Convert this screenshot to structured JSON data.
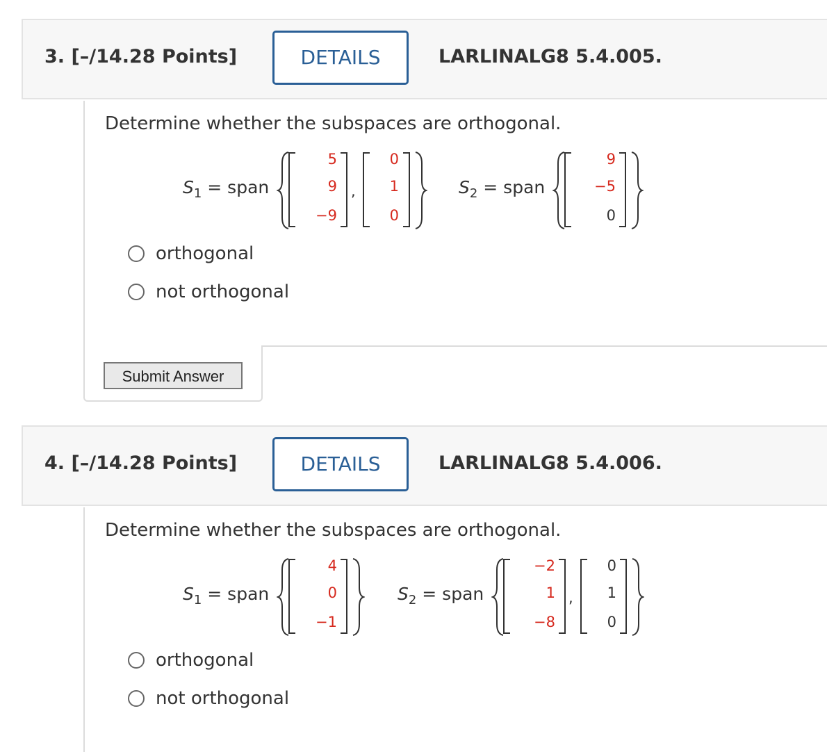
{
  "questions": [
    {
      "number_label": "3. [–/14.28 Points]",
      "details_label": "DETAILS",
      "book_code": "LARLINALG8 5.4.005.",
      "prompt": "Determine whether the subspaces are orthogonal.",
      "s1_label": "S",
      "s1_sub": "1",
      "s2_label": "S",
      "s2_sub": "2",
      "eq_span": " = span",
      "s1_vectors": [
        [
          "5",
          "9",
          "−9"
        ],
        [
          "0",
          "1",
          "0"
        ]
      ],
      "s2_vectors": [
        [
          "9",
          "−5",
          "0"
        ]
      ],
      "comma": ",",
      "options": [
        "orthogonal",
        "not orthogonal"
      ],
      "submit_label": "Submit Answer"
    },
    {
      "number_label": "4. [–/14.28 Points]",
      "details_label": "DETAILS",
      "book_code": "LARLINALG8 5.4.006.",
      "prompt": "Determine whether the subspaces are orthogonal.",
      "s1_label": "S",
      "s1_sub": "1",
      "s2_label": "S",
      "s2_sub": "2",
      "eq_span": " = span",
      "s1_vectors": [
        [
          "4",
          "0",
          "−1"
        ]
      ],
      "s2_vectors": [
        [
          "−2",
          "1",
          "−8"
        ],
        [
          "0",
          "1",
          "0"
        ]
      ],
      "comma": ",",
      "options": [
        "orthogonal",
        "not orthogonal"
      ]
    }
  ],
  "colors": {
    "accent_blue": "#2a5f96",
    "entry_red": "#d6291e",
    "header_bg": "#f7f7f7"
  },
  "icons": {
    "radio": "radio-unchecked-icon"
  }
}
